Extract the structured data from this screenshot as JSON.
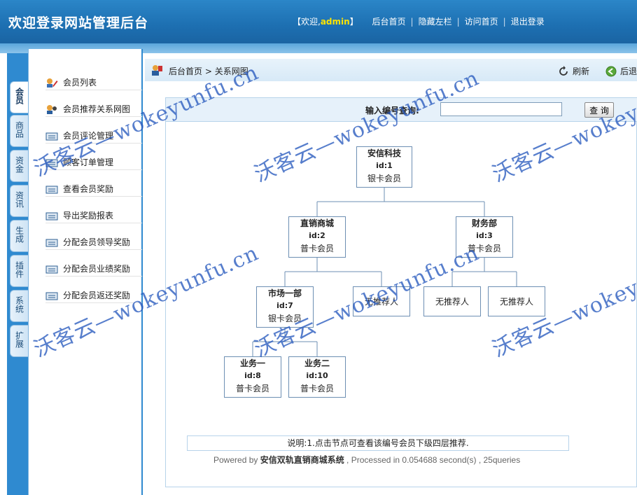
{
  "header": {
    "title": "欢迎登录网站管理后台",
    "welcome_prefix": "【欢迎,",
    "admin_name": "admin",
    "welcome_suffix": "】",
    "links": [
      "后台首页",
      "隐藏左栏",
      "访问首页",
      "退出登录"
    ]
  },
  "tabs": [
    "会员",
    "商品",
    "资金",
    "资讯",
    "生成",
    "插件",
    "系统",
    "扩展"
  ],
  "menu": [
    {
      "label": "会员列表",
      "icon": "edit-user-icon"
    },
    {
      "label": "会员推荐关系网图",
      "icon": "user-network-icon"
    },
    {
      "label": "会员评论管理",
      "icon": "folder-list-icon"
    },
    {
      "label": "顾客订单管理",
      "icon": "folder-list-icon"
    },
    {
      "label": "查看会员奖励",
      "icon": "folder-list-icon"
    },
    {
      "label": "导出奖励报表",
      "icon": "folder-list-icon"
    },
    {
      "label": "分配会员领导奖励",
      "icon": "folder-list-icon"
    },
    {
      "label": "分配会员业绩奖励",
      "icon": "folder-list-icon"
    },
    {
      "label": "分配会员返还奖励",
      "icon": "folder-list-icon"
    }
  ],
  "breadcrumb": {
    "home": "后台首页",
    "sep": ">",
    "current": "关系网图"
  },
  "toolbar": {
    "refresh": "刷新",
    "back": "后退"
  },
  "search": {
    "label": "输入编号查询:",
    "value": "",
    "button": "查 询"
  },
  "tree": {
    "n1": {
      "name": "安信科技",
      "id": "id:1",
      "level": "银卡会员"
    },
    "n2": {
      "name": "直销商城",
      "id": "id:2",
      "level": "普卡会员"
    },
    "n3": {
      "name": "财务部",
      "id": "id:3",
      "level": "普卡会员"
    },
    "n7": {
      "name": "市场一部",
      "id": "id:7",
      "level": "银卡会员"
    },
    "n8": {
      "name": "业务一",
      "id": "id:8",
      "level": "普卡会员"
    },
    "n10": {
      "name": "业务二",
      "id": "id:10",
      "level": "普卡会员"
    },
    "empty": "无推荐人"
  },
  "note": "说明:1.点击节点可查看该编号会员下级四层推荐.",
  "footer": {
    "prefix": "Powered by ",
    "brand": "安信双轨直销商城系统",
    "suffix": " , Processed in 0.054688 second(s) , 25queries"
  },
  "watermark": "沃客云—wokeyunfu.cn"
}
